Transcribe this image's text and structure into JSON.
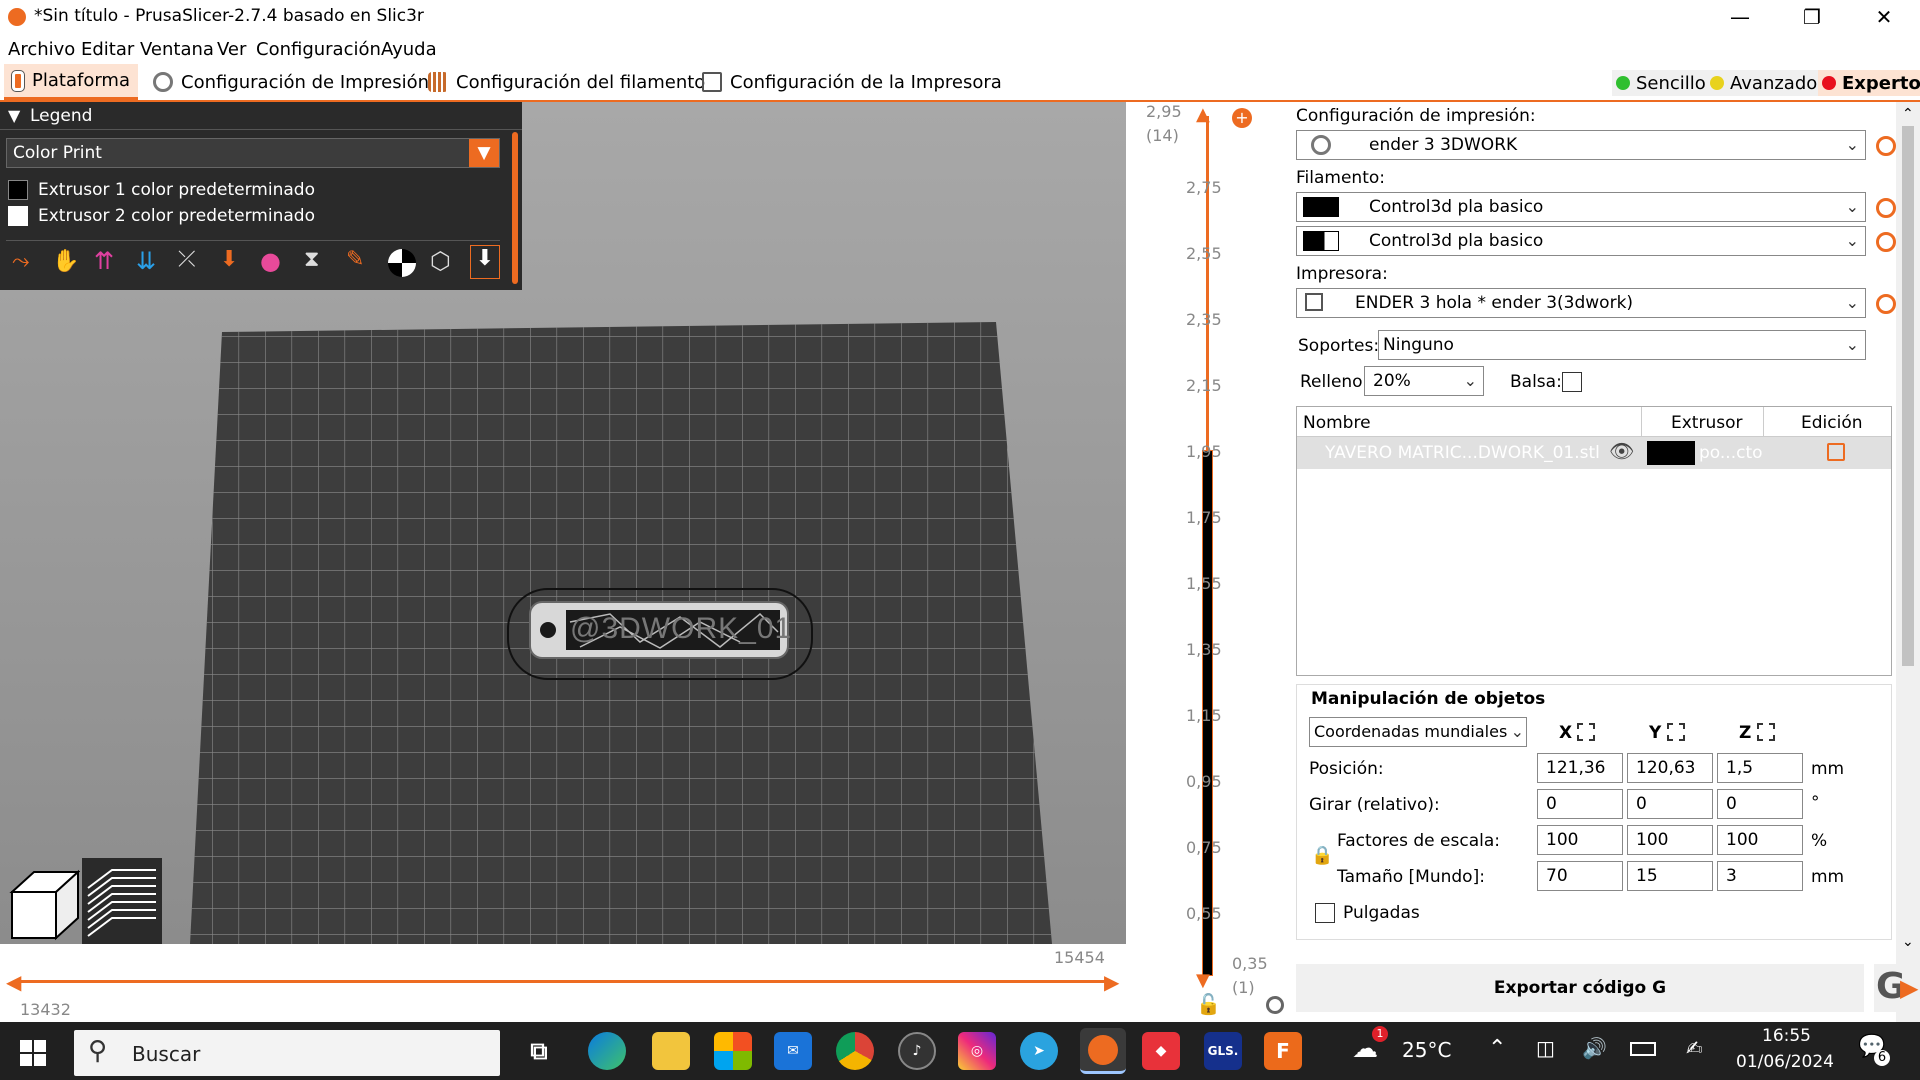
{
  "window": {
    "title": "*Sin título - PrusaSlicer-2.7.4 basado en Slic3r",
    "minimize": "—",
    "maximize": "❐",
    "close": "✕"
  },
  "menu": [
    "Archivo",
    "Editar",
    "Ventana",
    "Ver",
    "Configuración",
    "Ayuda"
  ],
  "tabs": [
    {
      "label": "Plataforma"
    },
    {
      "label": "Configuración de Impresión"
    },
    {
      "label": "Configuración del filamento"
    },
    {
      "label": "Configuración de la Impresora"
    }
  ],
  "modes": [
    {
      "label": "Sencillo",
      "color": "#2fbf2f"
    },
    {
      "label": "Avanzado",
      "color": "#e8d21d"
    },
    {
      "label": "Experto",
      "color": "#e8101d"
    }
  ],
  "legend": {
    "title": "Legend",
    "view_type": "Color Print",
    "extruders": [
      {
        "label": "Extrusor 1 color predeterminado",
        "color": "#000000"
      },
      {
        "label": "Extrusor 2 color predeterminado",
        "color": "#ffffff"
      }
    ]
  },
  "model_label": "@3DWORK_01",
  "horizontal_slider": {
    "right_value": "15454",
    "left_value": "13432"
  },
  "vertical_slider": {
    "top_value": "2,95",
    "top_layer": "(14)",
    "bottom_value": "0,35",
    "bottom_layer": "(1)",
    "ticks": [
      "2,75",
      "2,55",
      "2,35",
      "2,15",
      "1,95",
      "1,75",
      "1,55",
      "1,35",
      "1,15",
      "0,95",
      "0,75",
      "0,55"
    ]
  },
  "right_panel": {
    "print_settings_label": "Configuración de impresión:",
    "print_profile": "ender 3 3DWORK",
    "filament_label": "Filamento:",
    "filaments": [
      "Control3d pla basico",
      "Control3d pla basico"
    ],
    "printer_label": "Impresora:",
    "printer_profile": "ENDER 3 hola * ender 3(3dwork)",
    "supports_label": "Soportes:",
    "supports_value": "Ninguno",
    "infill_label": "Relleno:",
    "infill_value": "20%",
    "brim_label": "Balsa:",
    "object_list": {
      "col_name": "Nombre",
      "col_extruder": "Extrusor",
      "col_edit": "Edición",
      "row_name": "YAVERO MATRIC...DWORK_01.stl",
      "row_extruder": "po...cto"
    },
    "manipulation": {
      "title": "Manipulación de objetos",
      "coord_system": "Coordenadas mundiales",
      "axis_x": "X",
      "axis_y": "Y",
      "axis_z": "Z",
      "position_label": "Posición:",
      "position": [
        "121,36",
        "120,63",
        "1,5"
      ],
      "position_unit": "mm",
      "rotate_label": "Girar (relativo):",
      "rotate": [
        "0",
        "0",
        "0"
      ],
      "rotate_unit": "°",
      "scale_label": "Factores de escala:",
      "scale": [
        "100",
        "100",
        "100"
      ],
      "scale_unit": "%",
      "size_label": "Tamaño [Mundo]:",
      "size": [
        "70",
        "15",
        "3"
      ],
      "size_unit": "mm",
      "inches_label": "Pulgadas"
    },
    "export_button": "Exportar código G",
    "export_icon_letter": "G"
  },
  "taskbar": {
    "search_placeholder": "Buscar",
    "weather": "25°C",
    "weather_badge": "1",
    "time": "16:55",
    "date": "01/06/2024",
    "notification_count": "6",
    "gls_label": "GLS.",
    "fus_label": "F"
  }
}
